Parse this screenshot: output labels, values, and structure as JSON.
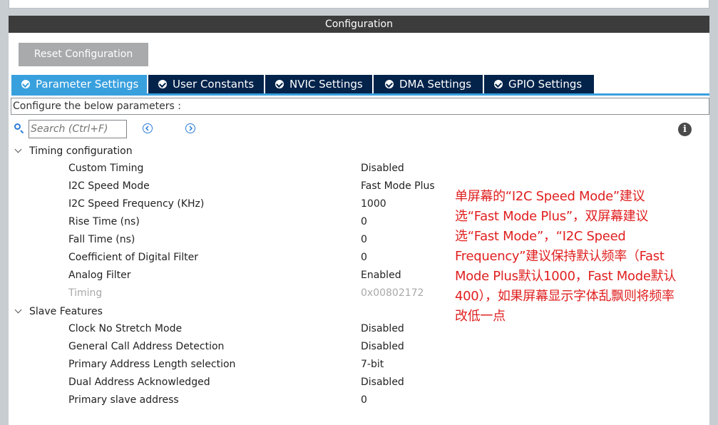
{
  "window": {
    "title": "Configuration"
  },
  "reset_button": "Reset Configuration",
  "tabs": [
    {
      "label": "Parameter Settings",
      "active": true
    },
    {
      "label": "User Constants",
      "active": false
    },
    {
      "label": "NVIC Settings",
      "active": false
    },
    {
      "label": "DMA Settings",
      "active": false
    },
    {
      "label": "GPIO Settings",
      "active": false
    }
  ],
  "configure_text": "Configure the below parameters :",
  "search": {
    "placeholder": "Search (Ctrl+F)"
  },
  "colors": {
    "active_tab": "#39a0de",
    "inactive_tab": "#03234b",
    "annotation": "#e02020"
  },
  "groups": {
    "timing": {
      "label": "Timing configuration",
      "rows": [
        {
          "label": "Custom Timing",
          "value": "Disabled"
        },
        {
          "label": "I2C Speed Mode",
          "value": "Fast Mode Plus"
        },
        {
          "label": "I2C Speed Frequency (KHz)",
          "value": "1000"
        },
        {
          "label": "Rise Time (ns)",
          "value": "0"
        },
        {
          "label": "Fall Time (ns)",
          "value": "0"
        },
        {
          "label": "Coefficient of Digital Filter",
          "value": "0"
        },
        {
          "label": "Analog Filter",
          "value": "Enabled"
        },
        {
          "label": "Timing",
          "value": "0x00802172"
        }
      ]
    },
    "slave": {
      "label": "Slave Features",
      "rows": [
        {
          "label": "Clock No Stretch Mode",
          "value": "Disabled"
        },
        {
          "label": "General Call Address Detection",
          "value": "Disabled"
        },
        {
          "label": "Primary Address Length selection",
          "value": "7-bit"
        },
        {
          "label": "Dual Address Acknowledged",
          "value": "Disabled"
        },
        {
          "label": "Primary slave address",
          "value": "0"
        }
      ]
    }
  },
  "annotation": {
    "lines": [
      "单屏幕的“I2C Speed Mode”建议",
      "选“Fast Mode Plus”，双屏幕建议",
      "选“Fast Mode”，“I2C Speed",
      "Frequency”建议保持默认频率（Fast",
      "Mode Plus默认1000，Fast Mode默认",
      "400），如果屏幕显示字体乱飘则将频率",
      "改低一点"
    ]
  }
}
